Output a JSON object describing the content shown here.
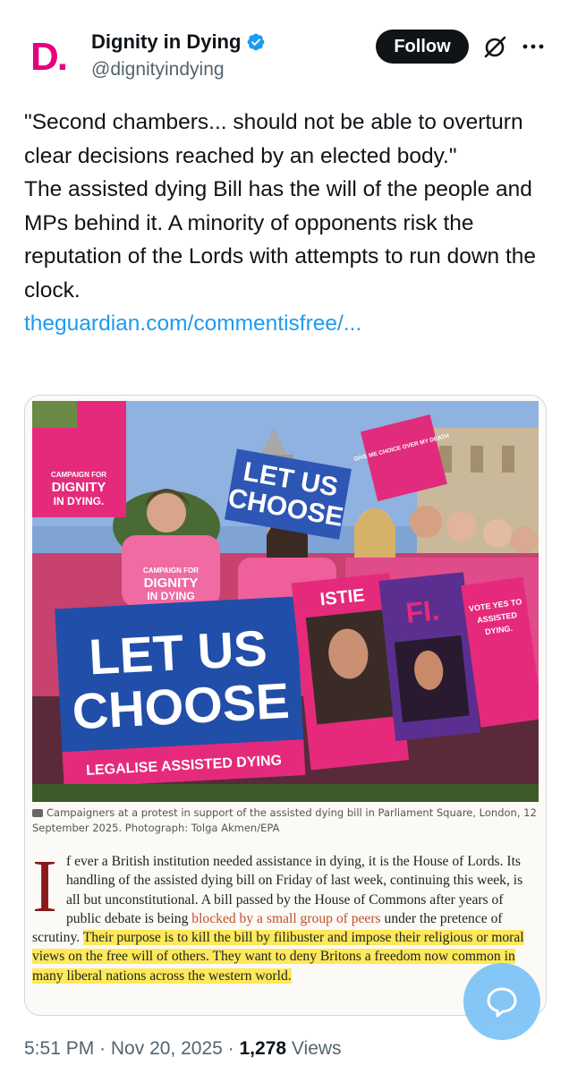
{
  "post": {
    "display_name": "Dignity in Dying",
    "handle": "@dignityindying",
    "follow_label": "Follow",
    "text_lines": [
      "\"Second chambers... should not be able to overturn clear decisions reached by an elected body.\"",
      "The assisted dying Bill has the will of the people and MPs behind it. A minority of opponents risk the reputation of the Lords with attempts to run down the clock."
    ],
    "link": "theguardian.com/commentisfree/...",
    "time": "5:51 PM",
    "date": "Nov 20, 2025",
    "views_count": "1,278",
    "views_label": "Views"
  },
  "avatar": {
    "letter": "D."
  },
  "icons": {
    "verified": "verified-badge-icon",
    "grok": "grok-icon",
    "more": "more-icon",
    "camera": "camera-icon",
    "chat": "chat-bubble-icon"
  },
  "colors": {
    "brand_pink": "#e5007e",
    "link": "#1d9bf0",
    "highlight": "#fde95a",
    "follow_bg": "#0f1419"
  },
  "photo": {
    "signs": {
      "big_line1": "LET US",
      "big_line2": "CHOOSE",
      "big_line3": "LEGALISE ASSISTED DYING",
      "mid_line1": "LET US",
      "mid_line2": "CHOOSE",
      "pink_left_1": "CAMPAIGN FOR",
      "pink_left_2": "DIGNITY",
      "pink_left_3": "IN DYING.",
      "vote_1": "VOTE YES TO",
      "vote_2": "ASSISTED",
      "vote_3": "DYING.",
      "fi": "FI.",
      "stie": "ISTIE",
      "choice": "GIVE ME CHOICE OVER MY DEATH",
      "shirt_1": "CAMPAIGN FOR",
      "shirt_2": "DIGNITY",
      "shirt_3": "IN DYING"
    }
  },
  "article": {
    "caption": "Campaigners at a protest in support of the assisted dying bill in Parliament Square, London, 12 September 2025. Photograph: Tolga Akmen/EPA",
    "drop_cap": "I",
    "body_plain_1": "f ever a British institution needed assistance in dying, it is the House of Lords. Its handling of the assisted dying bill on Friday of last week, continuing this week, is all but unconstitutional. A bill passed by the House of Commons after years of public debate is being ",
    "body_link": "blocked by a small group of peers",
    "body_plain_2": " under the pretence of scrutiny. ",
    "body_highlight": "Their purpose is to kill the bill by filibuster and impose their religious or moral views on the free will of others. They want to deny Britons a freedom now common in many liberal nations across the western world."
  }
}
